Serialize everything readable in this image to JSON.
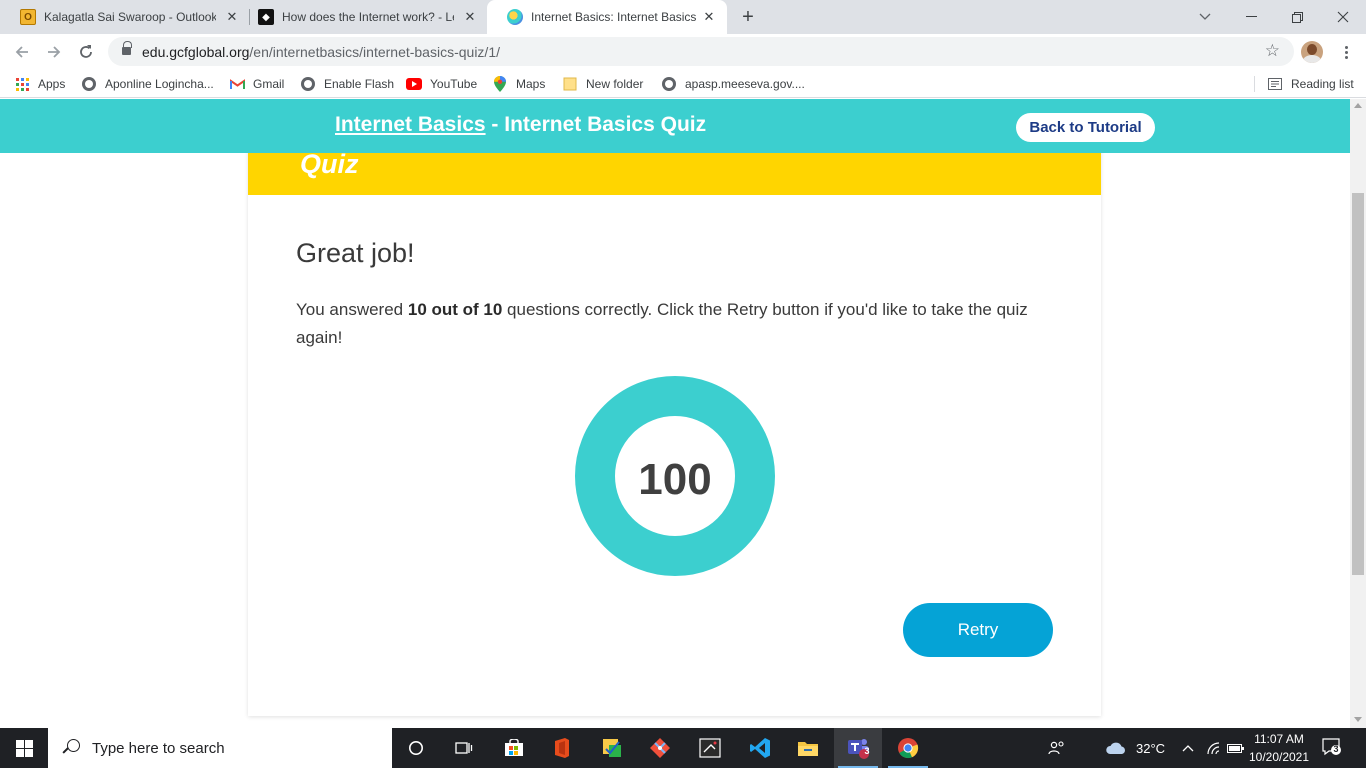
{
  "browser": {
    "tabs": [
      {
        "title": "Kalagatla Sai Swaroop - Outlook",
        "active": false
      },
      {
        "title": "How does the Internet work? - Le",
        "active": false
      },
      {
        "title": "Internet Basics: Internet Basics Qu",
        "active": true
      }
    ],
    "url_host": "edu.gcfglobal.org",
    "url_path": "/en/internetbasics/internet-basics-quiz/1/",
    "bookmarks": [
      {
        "label": "Apps",
        "icon": "apps-grid-icon"
      },
      {
        "label": "Aponline Logincha...",
        "icon": "globe-icon"
      },
      {
        "label": "Gmail",
        "icon": "gmail-icon"
      },
      {
        "label": "Enable Flash",
        "icon": "globe-icon"
      },
      {
        "label": "YouTube",
        "icon": "youtube-icon"
      },
      {
        "label": "Maps",
        "icon": "maps-pin-icon"
      },
      {
        "label": "New folder",
        "icon": "folder-icon"
      },
      {
        "label": "apasp.meeseva.gov....",
        "icon": "globe-icon"
      }
    ],
    "reading_list": "Reading list"
  },
  "page": {
    "header": {
      "link": "Internet Basics",
      "separator": " - ",
      "title": "Internet Basics Quiz",
      "back_button": "Back to Tutorial"
    },
    "banner_title": "Quiz",
    "heading": "Great job!",
    "result": {
      "prefix": "You answered ",
      "score_text": "10 out of 10",
      "suffix": " questions correctly. Click the Retry button if you'd like to take the quiz again!"
    },
    "score": "100",
    "retry_button": "Retry"
  },
  "taskbar": {
    "search_placeholder": "Type here to search",
    "temperature": "32°C",
    "time": "11:07 AM",
    "date": "10/20/2021",
    "teams_badge": "3",
    "notification_count": "3"
  },
  "colors": {
    "header_teal": "#3ccfcf",
    "banner_yellow": "#ffd500",
    "retry_blue": "#05a3d6",
    "donut_teal": "#3ccfcf"
  }
}
